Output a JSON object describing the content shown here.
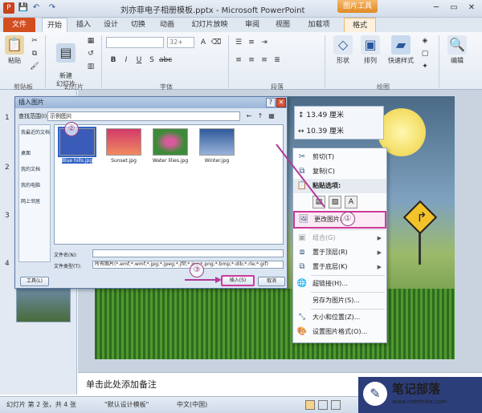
{
  "window": {
    "title": "刘亦菲电子相册模板.pptx - Microsoft PowerPoint",
    "context_tab_group": "图片工具",
    "app_icon": "P"
  },
  "tabs": [
    "文件",
    "开始",
    "插入",
    "设计",
    "切换",
    "动画",
    "幻灯片放映",
    "审阅",
    "视图",
    "加载项",
    "格式"
  ],
  "ribbon": {
    "paste": "粘贴",
    "new_slide": "新建\n幻灯片",
    "shape": "形状",
    "arrange": "排列",
    "quick_style": "快速样式",
    "edit": "编辑",
    "font_size_placeholder": "32+",
    "groups": [
      "剪贴板",
      "幻灯片",
      "字体",
      "段落",
      "绘图"
    ]
  },
  "size_toolbar": {
    "height": "13.49 厘米",
    "width": "10.39 厘米"
  },
  "dialog": {
    "title": "插入图片",
    "look_in_label": "查找范围(I):",
    "look_in_value": "示例图片",
    "places": [
      "我最近的文档",
      "桌面",
      "我的文档",
      "我的电脑",
      "网上邻居"
    ],
    "files": [
      {
        "name": "Blue hills.jpg",
        "color": "#3b5bb8",
        "selected": true
      },
      {
        "name": "Sunset.jpg",
        "color": "#d23a6a"
      },
      {
        "name": "Water lilies.jpg",
        "color": "#3f8a3a"
      },
      {
        "name": "Winter.jpg",
        "color": "#2f5a9a"
      }
    ],
    "filename_label": "文件名(N):",
    "filetype_label": "文件类型(T):",
    "filetype_value": "所有图片(*.emf;*.wmf;*.jpg;*.jpeg;*.jfif;*.jpe;*.png;*.bmp;*.dib;*.rle;*.gif)",
    "tools_button": "工具(L)",
    "insert_button": "插入(S)",
    "cancel_button": "取消"
  },
  "context_menu": {
    "cut": "剪切(T)",
    "copy": "复制(C)",
    "paste_options": "粘贴选项:",
    "change_picture": "更改图片(A)...",
    "group": "组合(G)",
    "bring_front": "置于顶层(R)",
    "send_back": "置于底层(K)",
    "hyperlink": "超链接(H)...",
    "save_as_picture": "另存为图片(S)...",
    "size_position": "大小和位置(Z)...",
    "format_picture": "设置图片格式(O)..."
  },
  "annotations": [
    "①",
    "②",
    "③"
  ],
  "slide_numbers": [
    "1",
    "2",
    "3",
    "4"
  ],
  "notes_placeholder": "单击此处添加备注",
  "status": {
    "slide_info": "幻灯片 第 2 张，共 4 张",
    "theme": "\"默认设计模板\"",
    "language": "中文(中国)"
  },
  "watermark": {
    "name": "笔记部落",
    "url": "www.notetribe.com"
  }
}
